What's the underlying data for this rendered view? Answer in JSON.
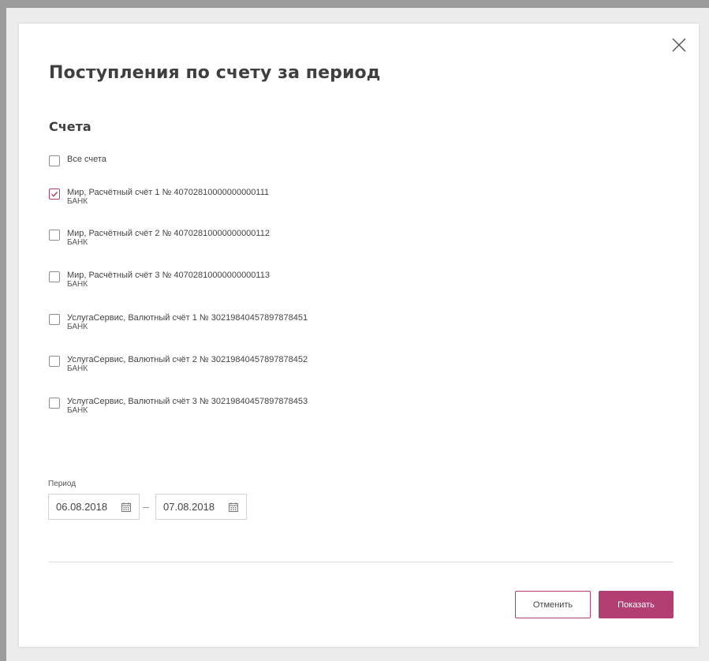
{
  "dialog": {
    "title": "Поступления по счету за период",
    "section_title": "Счета",
    "all_accounts_label": "Все счета",
    "accounts": [
      {
        "label": "Мир, Расчётный счёт 1 № 40702810000000000111",
        "bank": "БАНК",
        "checked": true
      },
      {
        "label": "Мир, Расчётный счёт 2  № 40702810000000000112",
        "bank": "БАНК",
        "checked": false
      },
      {
        "label": "Мир, Расчётный счёт 3 № 40702810000000000113",
        "bank": "БАНК",
        "checked": false
      },
      {
        "label": "УслугаСервис, Валютный счёт  1 № 30219840457897878451",
        "bank": "БАНК",
        "checked": false
      },
      {
        "label": "УслугаСервис, Валютный счёт  2 № 30219840457897878452",
        "bank": "БАНК",
        "checked": false
      },
      {
        "label": "УслугаСервис, Валютный счёт  3 № 30219840457897878453",
        "bank": "БАНК",
        "checked": false
      }
    ],
    "period_label": "Период",
    "date_from": "06.08.2018",
    "date_to": "07.08.2018",
    "cancel_label": "Отменить",
    "show_label": "Показать"
  },
  "colors": {
    "accent": "#b23e72",
    "background": "#ececec",
    "dialog_background": "#ffffff"
  },
  "icons": {
    "close": "close-icon",
    "calendar": "calendar-icon",
    "check": "check-icon"
  }
}
